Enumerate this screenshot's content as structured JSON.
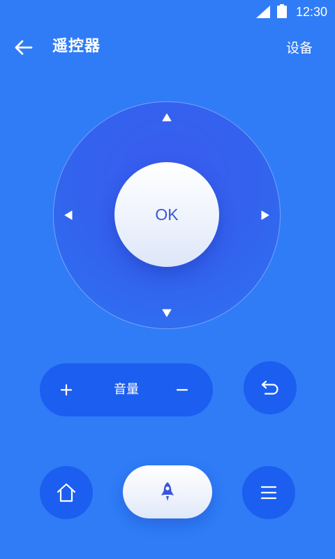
{
  "status_bar": {
    "time": "12:30",
    "icons": [
      "signal-icon",
      "battery-icon"
    ]
  },
  "header": {
    "back_icon": "arrow-left-icon",
    "title": "遥控器",
    "device_label": "设备"
  },
  "remote": {
    "dpad": {
      "up_icon": "triangle-up-icon",
      "down_icon": "triangle-down-icon",
      "left_icon": "triangle-left-icon",
      "right_icon": "triangle-right-icon"
    },
    "ok_label": "OK",
    "volume": {
      "plus": "+",
      "label": "音量",
      "minus": "−"
    },
    "buttons": {
      "return_icon": "return-icon",
      "home_icon": "home-icon",
      "boost_icon": "rocket-icon",
      "menu_icon": "menu-icon"
    }
  },
  "colors": {
    "background": "#2f7cf6",
    "button_fill": "#1b5ef0",
    "dpad_fill": "#3264ee",
    "ok_text": "#3a55d9",
    "boost_icon": "#3a55d9"
  }
}
